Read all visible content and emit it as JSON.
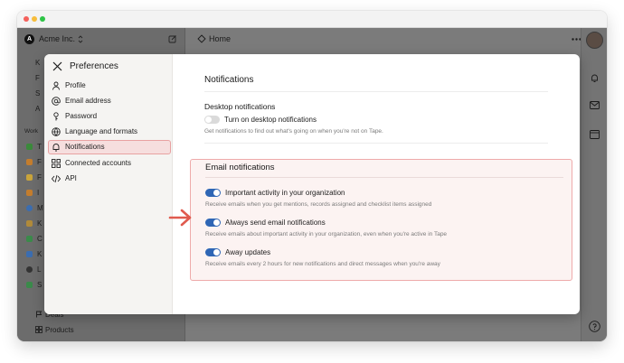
{
  "window": {
    "dots": [
      "#f4605b",
      "#f7bd3b",
      "#2dc446"
    ]
  },
  "app": {
    "workspace_logo": "A",
    "workspace_name": "Acme Inc.",
    "home_label": "Home",
    "sidebar_fragments": [
      "K",
      "F",
      "S",
      "A",
      "Work"
    ],
    "workspace_letters": [
      "T",
      "F",
      "F",
      "I",
      "M",
      "K",
      "C",
      "K",
      "L",
      "S"
    ],
    "workspace_colors": [
      "#3a8a3a",
      "#c47d2d",
      "#c9a43a",
      "#c47d2d",
      "#3b6db0",
      "#b08a3a",
      "#3a8a4a",
      "#3b6db0",
      "#333333",
      "#3a8a4a"
    ],
    "bottom_items": [
      "Deals",
      "Products"
    ]
  },
  "modal": {
    "title": "Preferences",
    "nav": [
      {
        "label": "Profile",
        "icon": "user-icon"
      },
      {
        "label": "Email address",
        "icon": "at-sign-icon"
      },
      {
        "label": "Password",
        "icon": "key-icon"
      },
      {
        "label": "Language and formats",
        "icon": "globe-icon"
      },
      {
        "label": "Notifications",
        "icon": "bell-icon",
        "active": true
      },
      {
        "label": "Connected accounts",
        "icon": "grid-icon"
      },
      {
        "label": "API",
        "icon": "code-icon"
      }
    ],
    "section_title": "Notifications",
    "desktop": {
      "title": "Desktop notifications",
      "toggle_label": "Turn on desktop notifications",
      "toggle_on": false,
      "description": "Get notifications to find out what's going on when you're not on Tape."
    },
    "email": {
      "title": "Email notifications",
      "items": [
        {
          "label": "Important activity in your organization",
          "description": "Receive emails when you get mentions, records assigned and checklist items assigned",
          "on": true
        },
        {
          "label": "Always send email notifications",
          "description": "Receive emails about important activity in your organization, even when you're active in Tape",
          "on": true
        },
        {
          "label": "Away updates",
          "description": "Receive emails every 2 hours for new notifications and direct messages when you're away",
          "on": true
        }
      ]
    }
  },
  "colors": {
    "accent": "#2f66b5",
    "highlight_border": "#eeaaaa",
    "arrow": "#e05a4e"
  }
}
